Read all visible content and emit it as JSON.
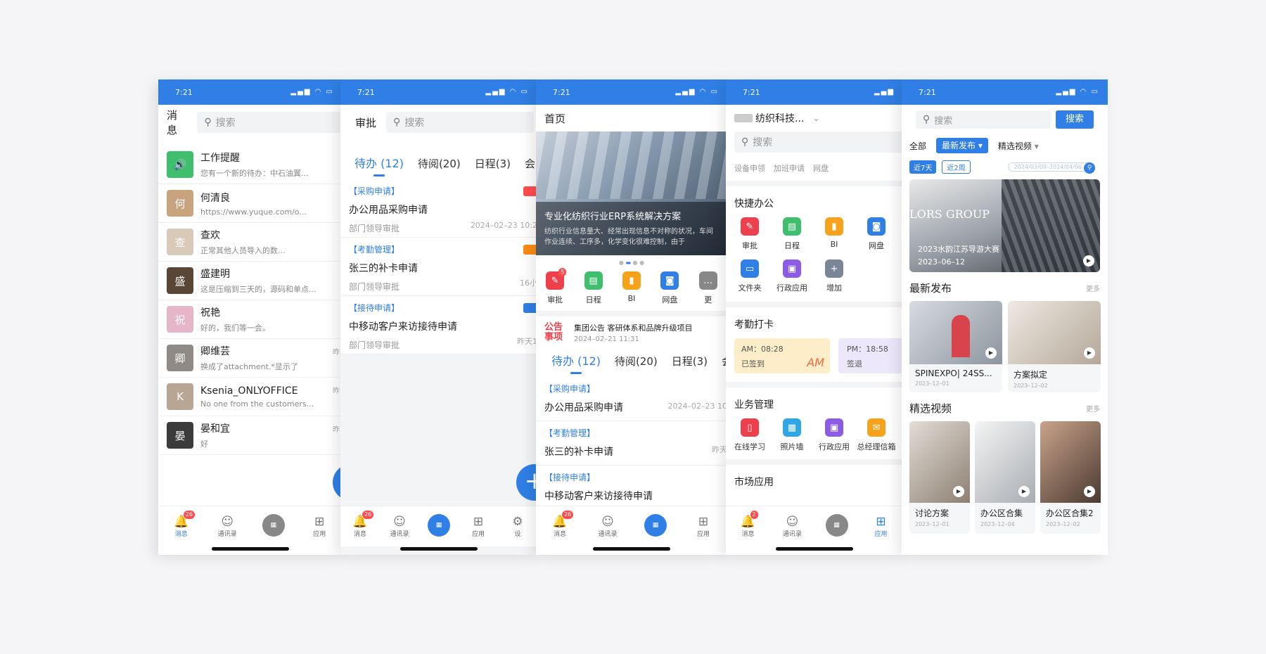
{
  "status": {
    "time": "7:21"
  },
  "phone1": {
    "header_title": "消息",
    "search_placeholder": "搜索",
    "messages": [
      {
        "name": "工作提醒",
        "preview": "您有一个新的待办：中石油翼...",
        "time": ""
      },
      {
        "name": "何清良",
        "preview": "https://www.yuque.com/o...",
        "time": ""
      },
      {
        "name": "查欢",
        "preview": "正常其他人员导入的数...",
        "time": ""
      },
      {
        "name": "盛建明",
        "preview": "这是压缩到三天的，源码和单点...",
        "time": ""
      },
      {
        "name": "祝艳",
        "preview": "好的，我们等一会。",
        "time": ""
      },
      {
        "name": "卿维芸",
        "preview": "换成了attachment.*显示了",
        "time": "昨"
      },
      {
        "name": "Ksenia_ONLYOFFICE",
        "preview": "No one from the customers...",
        "time": "昨"
      },
      {
        "name": "晏和宜",
        "preview": "好",
        "time": "昨"
      }
    ],
    "tabbar": [
      {
        "label": "消息",
        "badge": "26"
      },
      {
        "label": "通讯录"
      },
      {
        "label": ""
      },
      {
        "label": "应用"
      }
    ]
  },
  "phone2": {
    "header_title": "审批",
    "search_placeholder": "搜索",
    "tabs": [
      "待办 (12)",
      "待阅(20)",
      "日程(3)",
      "会"
    ],
    "items": [
      {
        "category": "【采购申请】",
        "title": "办公用品采购申请",
        "meta": "部门领导审批",
        "date": "2024–02–23 10:2",
        "tag_color": "#ff4d4f"
      },
      {
        "category": "【考勤管理】",
        "title": "张三的补卡申请",
        "meta": "部门领导审批",
        "date": "16小",
        "tag_color": "#fa8c16"
      },
      {
        "category": "【接待申请】",
        "title": "中移动客户来访接待申请",
        "meta": "部门领导审批",
        "date": "昨天1",
        "tag_color": "#2f7fe6"
      }
    ],
    "tabbar": [
      {
        "label": "消息",
        "badge": "26"
      },
      {
        "label": "通讯录"
      },
      {
        "label": ""
      },
      {
        "label": "应用"
      },
      {
        "label": "设"
      }
    ]
  },
  "phone3": {
    "header_title": "首页",
    "banner_title": "专业化纺织行业ERP系统解决方案",
    "banner_sub": "纺织行业信息量大、经常出现信息不对称的状况，车间作业连续、工序多，化学变化很难控制，由于",
    "apps": [
      {
        "label": "审批",
        "color": "#ee3f4d",
        "badge": "5"
      },
      {
        "label": "日程",
        "color": "#3fbf6e"
      },
      {
        "label": "BI",
        "color": "#f7a21b"
      },
      {
        "label": "网盘",
        "color": "#2f7fe6"
      },
      {
        "label": "更",
        "color": "#888888"
      }
    ],
    "notice_label": "公告事项",
    "notice_text": "集团公告  客研体系和品牌升级项目",
    "notice_date": "2024–02–21 11:31",
    "tabs": [
      "待办 (12)",
      "待阅(20)",
      "日程(3)",
      "会"
    ],
    "items": [
      {
        "category": "【采购申请】",
        "title": "办公用品采购申请",
        "date": "2024–02–23 10"
      },
      {
        "category": "【考勤管理】",
        "title": "张三的补卡申请",
        "date": "昨天"
      },
      {
        "category": "【接待申请】",
        "title": "中移动客户来访接待申请",
        "date": ""
      }
    ],
    "tabbar": [
      {
        "label": "消息",
        "badge": "26"
      },
      {
        "label": "通讯录"
      },
      {
        "label": ""
      },
      {
        "label": "应用"
      }
    ]
  },
  "phone4": {
    "org_name": "纺织科技...",
    "search_placeholder": "搜索",
    "quick_links": [
      "设备申领",
      "加班申请",
      "网盘"
    ],
    "sections": [
      {
        "title": "快捷办公"
      },
      {
        "title": "考勤打卡"
      },
      {
        "title": "业务管理"
      },
      {
        "title": "市场应用"
      }
    ],
    "quick_apps": [
      {
        "label": "审批",
        "color": "#ee3f4d"
      },
      {
        "label": "日程",
        "color": "#3fbf6e"
      },
      {
        "label": "BI",
        "color": "#f7a21b"
      },
      {
        "label": "网盘",
        "color": "#2f7fe6"
      },
      {
        "label": "文件夹",
        "color": "#2f7fe6"
      },
      {
        "label": "行政应用",
        "color": "#8c5ce6"
      },
      {
        "label": "增加",
        "color": "#7a8596"
      }
    ],
    "attendance": {
      "am_time": "AM：08:28",
      "am_status": "已签到",
      "am_mark": "AM",
      "pm_time": "PM：18:58",
      "pm_status": "签退"
    },
    "business_apps": [
      {
        "label": "在线学习",
        "color": "#ee3f4d"
      },
      {
        "label": "照片墙",
        "color": "#2fa6e6"
      },
      {
        "label": "行政应用",
        "color": "#8c5ce6"
      },
      {
        "label": "总经理信箱",
        "color": "#f7a21b"
      }
    ],
    "tabbar": [
      {
        "label": "消息",
        "badge": "2"
      },
      {
        "label": "通讯录"
      },
      {
        "label": ""
      },
      {
        "label": "应用"
      }
    ]
  },
  "phone5": {
    "search_placeholder": "搜索",
    "search_button": "搜索",
    "filters": [
      "全部",
      "最新发布",
      "精选视频"
    ],
    "date_chips": [
      "近7天",
      "近2周"
    ],
    "date_range": "2024/03/09–2024/04/06",
    "hero": {
      "title": "2023水韵江苏导游大赛",
      "date": "2023–06–12",
      "brand": "LORS GROUP"
    },
    "latest_title": "最新发布",
    "more": "更多",
    "latest": [
      {
        "title": "SPINEXPO| 24SS...",
        "date": "2023–12–01"
      },
      {
        "title": "方案拟定",
        "date": "2023–12–02"
      }
    ],
    "featured_title": "精选视频",
    "featured": [
      {
        "title": "讨论方案",
        "date": "2023–12–01"
      },
      {
        "title": "办公区合集",
        "date": "2023–12–04"
      },
      {
        "title": "办公区合集2",
        "date": "2023–12–02"
      }
    ]
  }
}
